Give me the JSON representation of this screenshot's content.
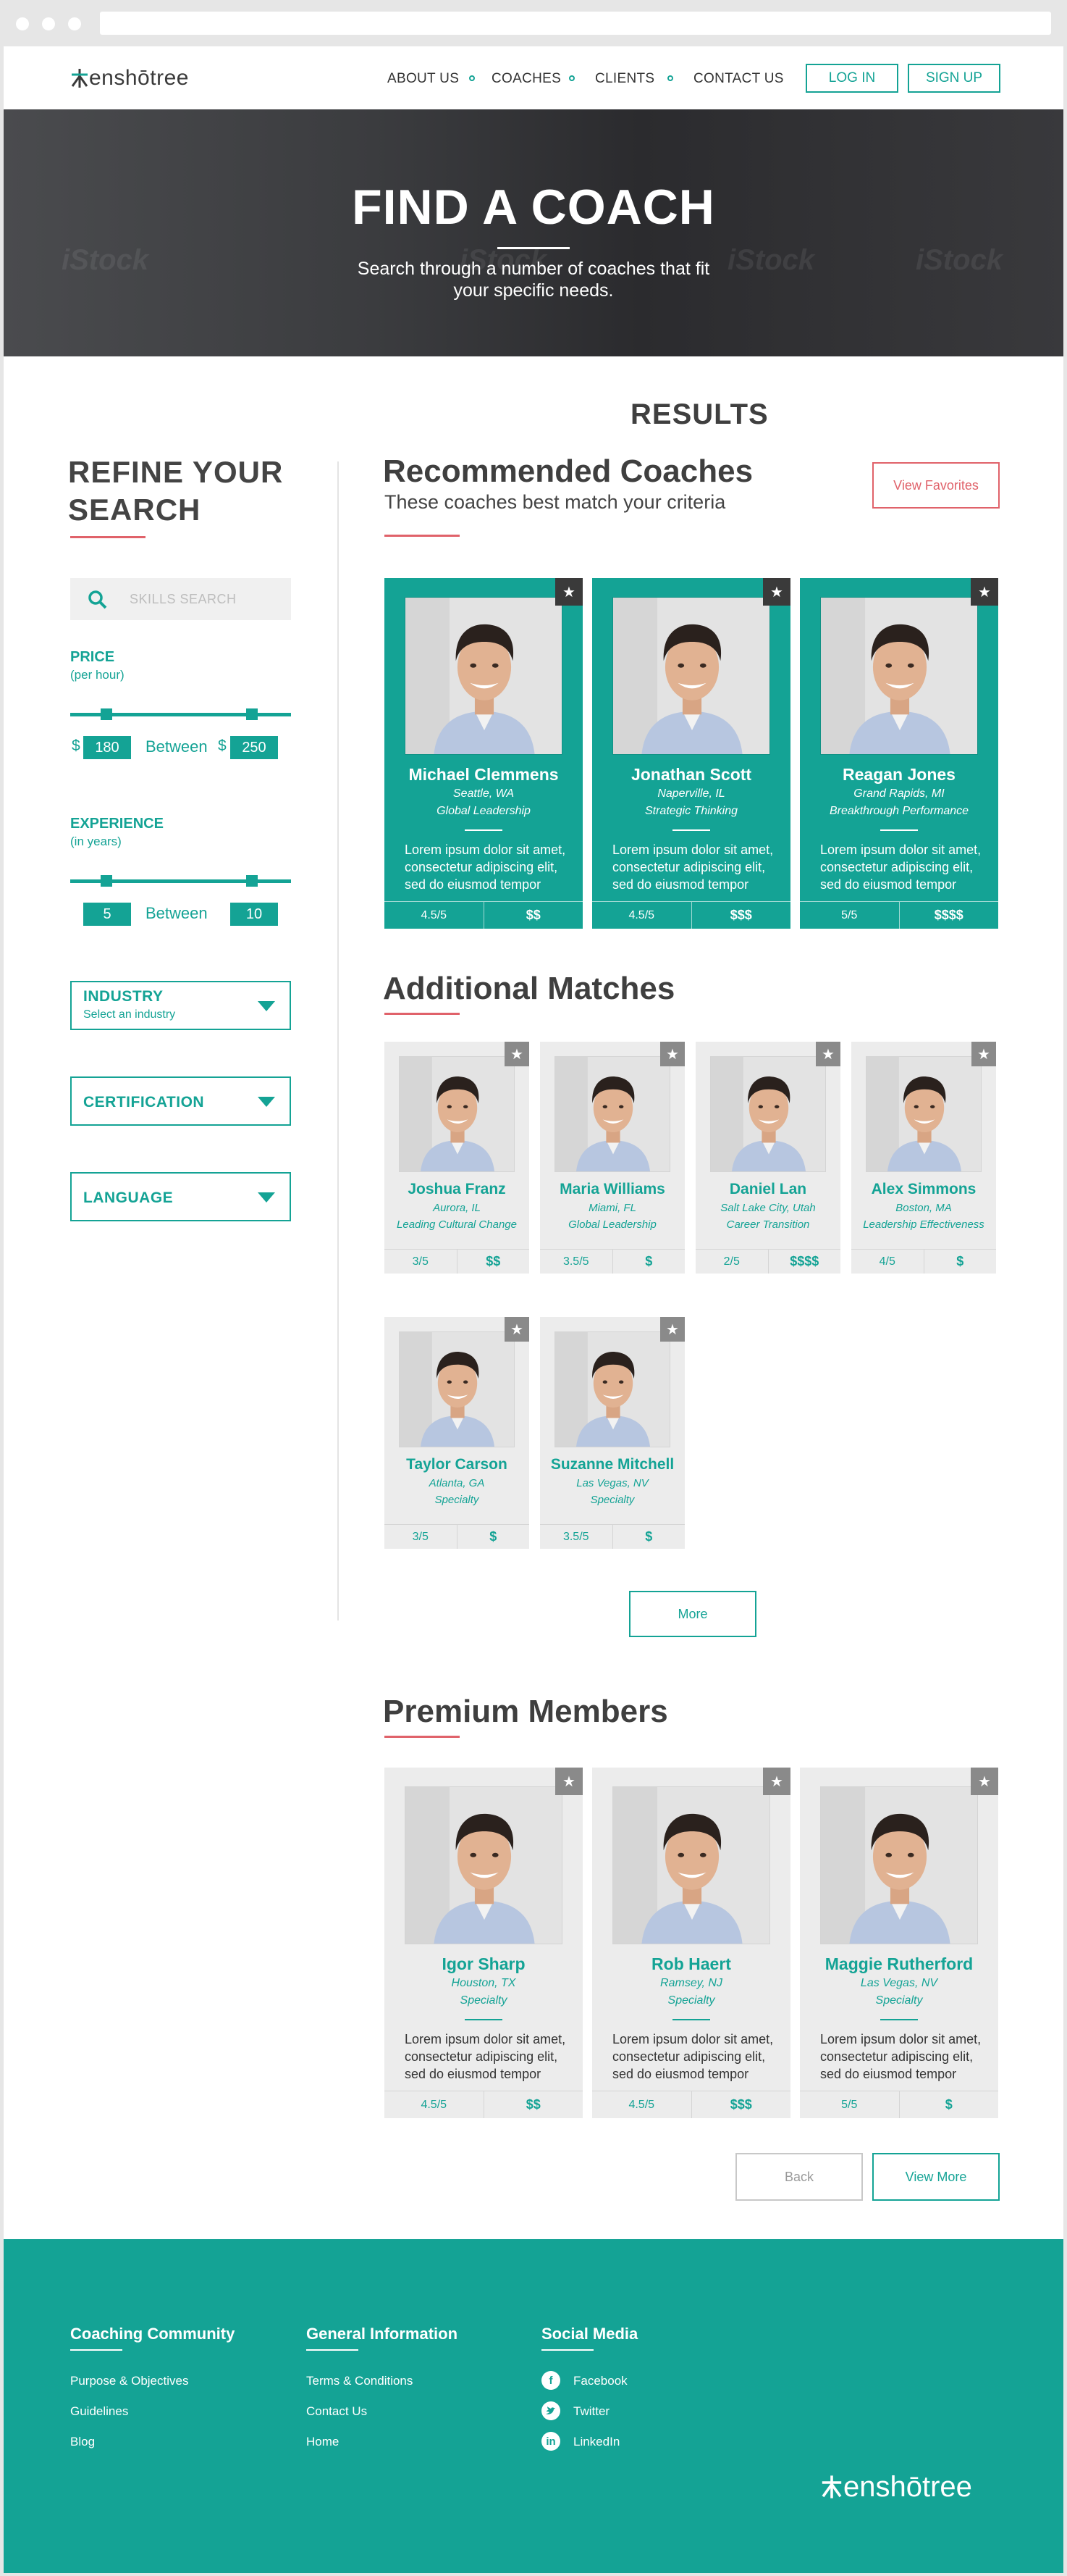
{
  "brand": {
    "logo_text": "enshōtree"
  },
  "nav": {
    "links": [
      "ABOUT US",
      "COACHES",
      "CLIENTS",
      "CONTACT US"
    ],
    "login": "LOG IN",
    "signup": "SIGN UP"
  },
  "hero": {
    "title": "FIND A COACH",
    "subtitle_line1": "Search through a number of coaches that fit",
    "subtitle_line2": "your specific needs.",
    "watermark": "iStock"
  },
  "results_heading": "RESULTS",
  "sidebar": {
    "title_line1": "REFINE YOUR",
    "title_line2": "SEARCH",
    "skills_placeholder": "SKILLS SEARCH",
    "price": {
      "label": "PRICE",
      "unit": "(per hour)",
      "currency": "$",
      "min": "180",
      "between": "Between",
      "max": "250"
    },
    "experience": {
      "label": "EXPERIENCE",
      "unit": "(in years)",
      "min": "5",
      "between": "Between",
      "max": "10"
    },
    "industry": {
      "label": "INDUSTRY",
      "placeholder": "Select an industry"
    },
    "certification": {
      "label": "CERTIFICATION"
    },
    "language": {
      "label": "LANGUAGE"
    }
  },
  "recommended": {
    "title": "Recommended Coaches",
    "subtitle": "These coaches best match your criteria",
    "view_favorites": "View Favorites",
    "coaches": [
      {
        "name": "Michael Clemmens",
        "location": "Seattle, WA",
        "specialty": "Global Leadership",
        "desc1": "Lorem ipsum dolor sit amet,",
        "desc2": "consectetur adipiscing elit,",
        "desc3": "sed do eiusmod tempor",
        "rating": "4.5/5",
        "price": "$$"
      },
      {
        "name": "Jonathan Scott",
        "location": "Naperville, IL",
        "specialty": "Strategic Thinking",
        "desc1": "Lorem ipsum dolor sit amet,",
        "desc2": "consectetur adipiscing elit,",
        "desc3": "sed do eiusmod tempor",
        "rating": "4.5/5",
        "price": "$$$"
      },
      {
        "name": "Reagan Jones",
        "location": "Grand Rapids, MI",
        "specialty": "Breakthrough Performance",
        "desc1": "Lorem ipsum dolor sit amet,",
        "desc2": "consectetur adipiscing elit,",
        "desc3": "sed do eiusmod tempor",
        "rating": "5/5",
        "price": "$$$$"
      }
    ]
  },
  "additional": {
    "title": "Additional Matches",
    "more": "More",
    "coaches": [
      {
        "name": "Joshua Franz",
        "location": "Aurora, IL",
        "specialty": "Leading Cultural Change",
        "rating": "3/5",
        "price": "$$"
      },
      {
        "name": "Maria Williams",
        "location": "Miami, FL",
        "specialty": "Global Leadership",
        "rating": "3.5/5",
        "price": "$"
      },
      {
        "name": "Daniel Lan",
        "location": "Salt Lake City, Utah",
        "specialty": "Career Transition",
        "rating": "2/5",
        "price": "$$$$"
      },
      {
        "name": "Alex Simmons",
        "location": "Boston, MA",
        "specialty": "Leadership Effectiveness",
        "rating": "4/5",
        "price": "$"
      },
      {
        "name": "Taylor Carson",
        "location": "Atlanta, GA",
        "specialty": "Specialty",
        "rating": "3/5",
        "price": "$"
      },
      {
        "name": "Suzanne Mitchell",
        "location": "Las Vegas, NV",
        "specialty": "Specialty",
        "rating": "3.5/5",
        "price": "$"
      }
    ]
  },
  "premium": {
    "title": "Premium Members",
    "back": "Back",
    "view_more": "View More",
    "coaches": [
      {
        "name": "Igor Sharp",
        "location": "Houston, TX",
        "specialty": "Specialty",
        "desc1": "Lorem ipsum dolor sit amet,",
        "desc2": "consectetur adipiscing elit,",
        "desc3": "sed do eiusmod tempor",
        "rating": "4.5/5",
        "price": "$$"
      },
      {
        "name": "Rob Haert",
        "location": "Ramsey, NJ",
        "specialty": "Specialty",
        "desc1": "Lorem ipsum dolor sit amet,",
        "desc2": "consectetur adipiscing elit,",
        "desc3": "sed do eiusmod tempor",
        "rating": "4.5/5",
        "price": "$$$"
      },
      {
        "name": "Maggie Rutherford",
        "location": "Las Vegas, NV",
        "specialty": "Specialty",
        "desc1": "Lorem ipsum dolor sit amet,",
        "desc2": "consectetur adipiscing elit,",
        "desc3": "sed do eiusmod tempor",
        "rating": "5/5",
        "price": "$"
      }
    ]
  },
  "footer": {
    "col1": {
      "title": "Coaching Community",
      "links": [
        "Purpose & Objectives",
        "Guidelines",
        "Blog"
      ]
    },
    "col2": {
      "title": "General Information",
      "links": [
        "Terms & Conditions",
        "Contact Us",
        "Home"
      ]
    },
    "col3": {
      "title": "Social Media",
      "links": [
        "Facebook",
        "Twitter",
        "LinkedIn"
      ]
    },
    "logo_text": "enshōtree"
  },
  "colors": {
    "accent": "#14a395",
    "underline": "#e0626a",
    "footer": "#14a395"
  },
  "icons": [
    "search-icon",
    "star-icon",
    "chevron-down-icon",
    "facebook-icon",
    "twitter-icon",
    "linkedin-icon",
    "tree-logo-icon"
  ]
}
